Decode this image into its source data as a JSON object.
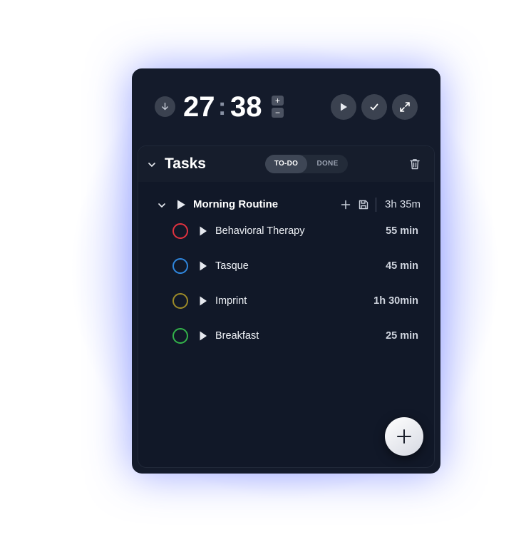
{
  "timer": {
    "minutes": "27",
    "separator": ":",
    "seconds": "38",
    "increment_label": "+",
    "decrement_label": "−"
  },
  "tasks_panel": {
    "title": "Tasks",
    "tabs": [
      {
        "label": "TO-DO",
        "active": true
      },
      {
        "label": "DONE",
        "active": false
      }
    ]
  },
  "group": {
    "title": "Morning Routine",
    "total": "3h 35m",
    "tasks": [
      {
        "name": "Behavioral Therapy",
        "duration": "55 min",
        "color": "#e0323f"
      },
      {
        "name": "Tasque",
        "duration": "45 min",
        "color": "#2f86dd"
      },
      {
        "name": "Imprint",
        "duration": "1h 30min",
        "color": "#9c8a28"
      },
      {
        "name": "Breakfast",
        "duration": "25 min",
        "color": "#33b24a"
      }
    ]
  },
  "colors": {
    "widget_bg": "#141b2b",
    "panel_bg": "#111828",
    "control_bg": "#3b4250",
    "accent_glow": "#7f8dff"
  },
  "icons": {
    "timer_toggle": "arrow-down-icon",
    "start": "play-icon",
    "complete": "check-icon",
    "expand": "expand-icon",
    "collapse": "chevron-down-icon",
    "clear": "trash-icon",
    "add": "plus-icon",
    "save": "save-icon"
  }
}
